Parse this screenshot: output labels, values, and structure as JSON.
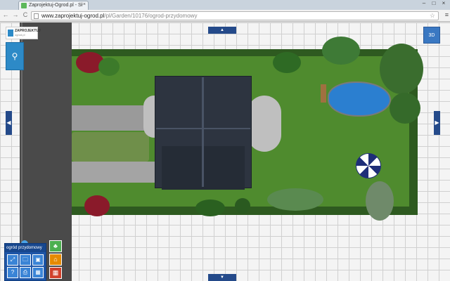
{
  "browser": {
    "tab_title": "Zaprojektuj-Ogrod.pl - Sł",
    "tab_close": "×",
    "url_domain": "www.zaprojektuj-ogrod.pl",
    "url_path": "/pl/Garden/10176/ogrod-przydomowy",
    "back": "←",
    "forward": "→",
    "reload": "C",
    "star": "☆",
    "menu": "≡",
    "win_minimize": "–",
    "win_maximize": "□",
    "win_close": "×"
  },
  "app": {
    "logo_text": "ZAPROJEKTUJ",
    "logo_sub": "ogrod.pl",
    "btn_3d": "3D",
    "arrow_up": "▲",
    "arrow_down": "▼",
    "arrow_left": "◀",
    "arrow_right": "▶",
    "panel_title": "ogród przydomowy",
    "tool_icon": "⚲",
    "panel_buttons": [
      "⤢",
      "🗀",
      "▣",
      "?",
      "⎙",
      "▦"
    ],
    "side_buttons": [
      "♣",
      "⌂",
      "▦"
    ]
  },
  "colors": {
    "accent": "#1e56a8",
    "lawn": "#4f8b2e",
    "roof": "#2d3440",
    "pond": "#2b7fd0"
  }
}
